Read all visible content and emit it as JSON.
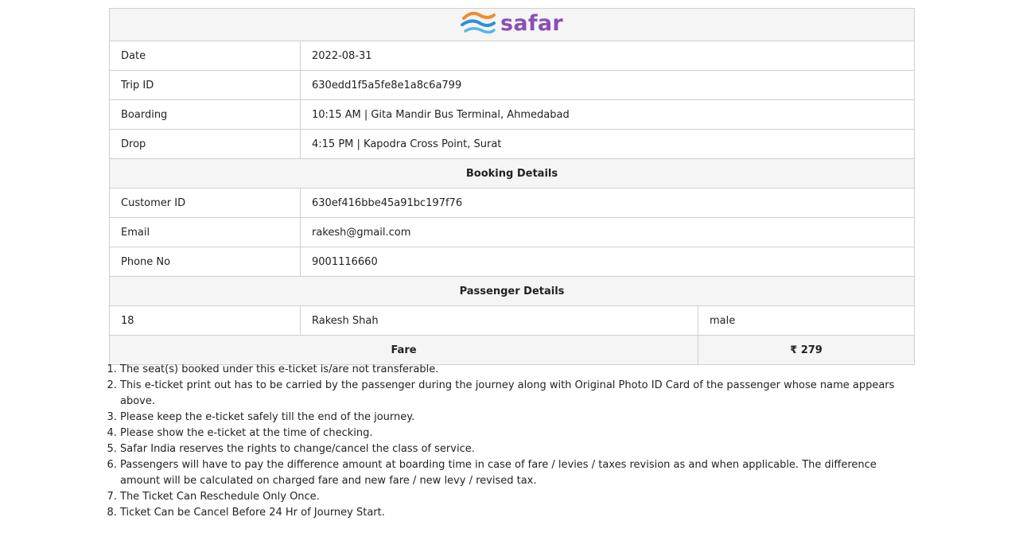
{
  "brand": {
    "name": "safar",
    "text_color": "#8a4fb8",
    "wave_colors": [
      "#f28c28",
      "#2f8fd8",
      "#54b8e8"
    ]
  },
  "trip": {
    "date_label": "Date",
    "date_value": "2022-08-31",
    "trip_id_label": "Trip ID",
    "trip_id_value": "630edd1f5a5fe8e1a8c6a799",
    "boarding_label": "Boarding",
    "boarding_value": "10:15 AM | Gita Mandir Bus Terminal, Ahmedabad",
    "drop_label": "Drop",
    "drop_value": "4:15 PM | Kapodra Cross Point, Surat"
  },
  "booking": {
    "heading": "Booking Details",
    "customer_id_label": "Customer ID",
    "customer_id_value": "630ef416bbe45a91bc197f76",
    "email_label": "Email",
    "email_value": "rakesh@gmail.com",
    "phone_label": "Phone No",
    "phone_value": "9001116660"
  },
  "passenger": {
    "heading": "Passenger Details",
    "age": "18",
    "name": "Rakesh Shah",
    "gender": "male"
  },
  "fare": {
    "label": "Fare",
    "value": "₹ 279"
  },
  "notes": [
    "The seat(s) booked under this e-ticket is/are not transferable.",
    "This e-ticket print out has to be carried by the passenger during the journey along with Original Photo ID Card of the passenger whose name appears above.",
    "Please keep the e-ticket safely till the end of the journey.",
    "Please show the e-ticket at the time of checking.",
    "Safar India reserves the rights to change/cancel the class of service.",
    "Passengers will have to pay the difference amount at boarding time in case of fare / levies / taxes revision as and when applicable. The difference amount will be calculated on charged fare and new fare / new levy / revised tax.",
    "The Ticket Can Reschedule Only Once.",
    "Ticket Can be Cancel Before 24 Hr of Journey Start."
  ]
}
